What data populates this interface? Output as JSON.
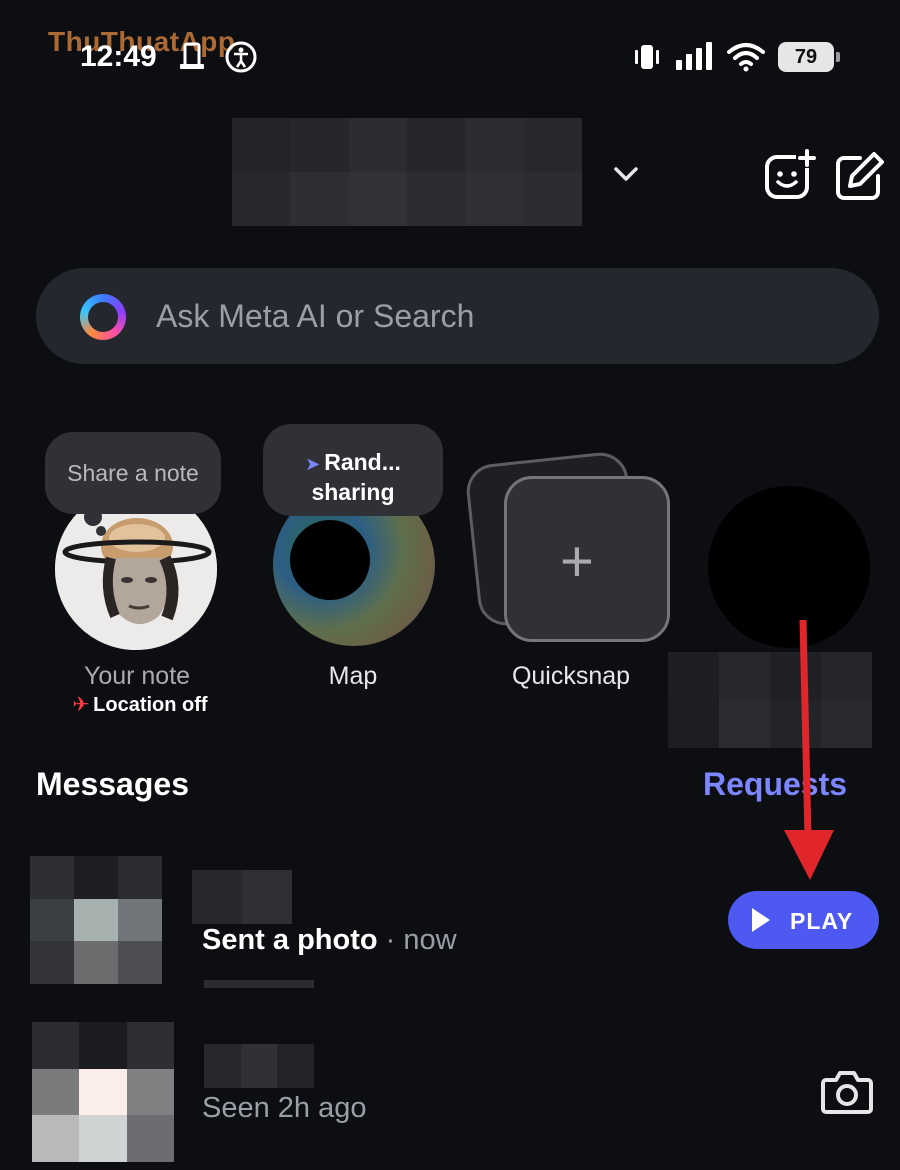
{
  "watermark": "ThuThuatApp",
  "status_bar": {
    "time": "12:49",
    "battery": "79"
  },
  "header": {
    "chevron": "chevron-down-icon",
    "icons": [
      "new-note-face-icon",
      "compose-icon"
    ]
  },
  "search": {
    "placeholder": "Ask Meta AI or Search",
    "icon": "meta-ai-ring-icon"
  },
  "notes": {
    "your_note": {
      "bubble": "Share a note",
      "label": "Your note",
      "sublabel": "Location off"
    },
    "map": {
      "bubble_line1": "Rand...",
      "bubble_line2": "sharing",
      "label": "Map"
    },
    "quicksnap": {
      "label": "Quicksnap"
    }
  },
  "messages": {
    "title": "Messages",
    "requests_label": "Requests",
    "threads": [
      {
        "preview_bold": "Sent a photo",
        "separator": " · ",
        "time": "now",
        "action_label": "PLAY"
      },
      {
        "preview": "Seen 2h ago",
        "action_icon": "camera-icon"
      }
    ]
  },
  "colors": {
    "background": "#0d0e12",
    "accent": "#4d59f1",
    "requests": "#7c86ff",
    "annotation_arrow": "#e0262b"
  }
}
